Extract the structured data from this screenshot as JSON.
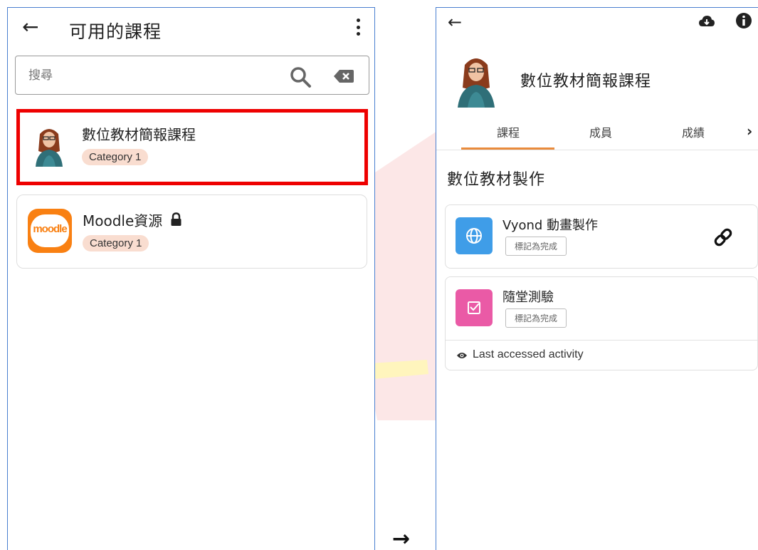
{
  "left_screen": {
    "title": "可用的課程",
    "search": {
      "placeholder": "搜尋",
      "value": ""
    },
    "courses": [
      {
        "name": "數位教材簡報課程",
        "category": "Category 1",
        "highlighted": true
      },
      {
        "name": "Moodle資源",
        "category": "Category 1",
        "locked": true,
        "logo_text": "moodle"
      }
    ]
  },
  "arrow": "→",
  "right_screen": {
    "course_title": "數位教材簡報課程",
    "tabs": [
      {
        "label": "課程",
        "active": true
      },
      {
        "label": "成員"
      },
      {
        "label": "成績"
      }
    ],
    "section_title": "數位教材製作",
    "activities": [
      {
        "name": "Vyond 動畫製作",
        "mark_complete": "標記為完成",
        "icon": "globe-icon",
        "color": "#3f9de8"
      },
      {
        "name": "隨堂測驗",
        "mark_complete": "標記為完成",
        "icon": "checkbox-icon",
        "color": "#ea5aa6"
      }
    ],
    "last_accessed": "Last accessed activity"
  },
  "colors": {
    "highlight": "#ee0000",
    "tab_underline": "#e98b3c",
    "badge_bg": "#f9ddd0",
    "moodle_orange": "#f98012",
    "frame": "#4a7fd0"
  }
}
